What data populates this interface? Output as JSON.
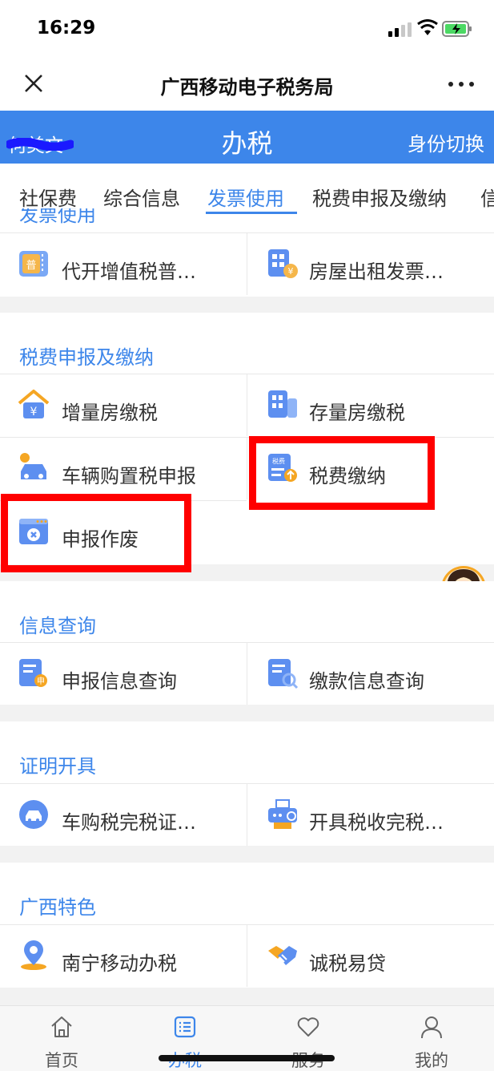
{
  "status_bar": {
    "time": "16:29"
  },
  "title_bar": {
    "title": "广西移动电子税务局"
  },
  "header": {
    "user_name": "何美文",
    "title": "办税",
    "switch_label": "身份切换"
  },
  "tabs": [
    {
      "label": "社保费",
      "active": false
    },
    {
      "label": "综合信息",
      "active": false
    },
    {
      "label": "发票使用",
      "active": true
    },
    {
      "label": "税费申报及缴纳",
      "active": false
    },
    {
      "label": "信",
      "active": false
    }
  ],
  "partial_heading": "发票使用",
  "sections": {
    "invoice": {
      "items": [
        {
          "label": "代开增值税普…",
          "icon": "invoice-ordinary-icon"
        },
        {
          "label": "房屋出租发票…",
          "icon": "house-rental-invoice-icon"
        }
      ]
    },
    "declare_pay": {
      "title": "税费申报及缴纳",
      "items": [
        {
          "label": "增量房缴税",
          "icon": "new-house-tax-icon"
        },
        {
          "label": "存量房缴税",
          "icon": "existing-house-tax-icon"
        },
        {
          "label": "车辆购置税申报",
          "icon": "vehicle-purchase-tax-icon"
        },
        {
          "label": "税费缴纳",
          "icon": "tax-payment-icon"
        },
        {
          "label": "申报作废",
          "icon": "declaration-void-icon"
        }
      ]
    },
    "info_query": {
      "title": "信息查询",
      "items": [
        {
          "label": "申报信息查询",
          "icon": "declaration-query-icon"
        },
        {
          "label": "缴款信息查询",
          "icon": "payment-query-icon"
        }
      ]
    },
    "certificate": {
      "title": "证明开具",
      "items": [
        {
          "label": "车购税完税证…",
          "icon": "vehicle-tax-certificate-icon"
        },
        {
          "label": "开具税收完税…",
          "icon": "tax-certificate-icon"
        }
      ]
    },
    "guangxi": {
      "title": "广西特色",
      "items": [
        {
          "label": "南宁移动办税",
          "icon": "location-pin-icon"
        },
        {
          "label": "诚税易贷",
          "icon": "handshake-icon"
        }
      ]
    }
  },
  "customer_service": {
    "label": "客服"
  },
  "bottom_nav": [
    {
      "label": "首页",
      "icon": "home-icon",
      "active": false
    },
    {
      "label": "办税",
      "icon": "list-icon",
      "active": true
    },
    {
      "label": "服务",
      "icon": "heart-icon",
      "active": false
    },
    {
      "label": "我的",
      "icon": "person-icon",
      "active": false
    }
  ],
  "colors": {
    "accent": "#3d86ea",
    "highlight": "#ff0000",
    "background": "#f2f2f2"
  }
}
